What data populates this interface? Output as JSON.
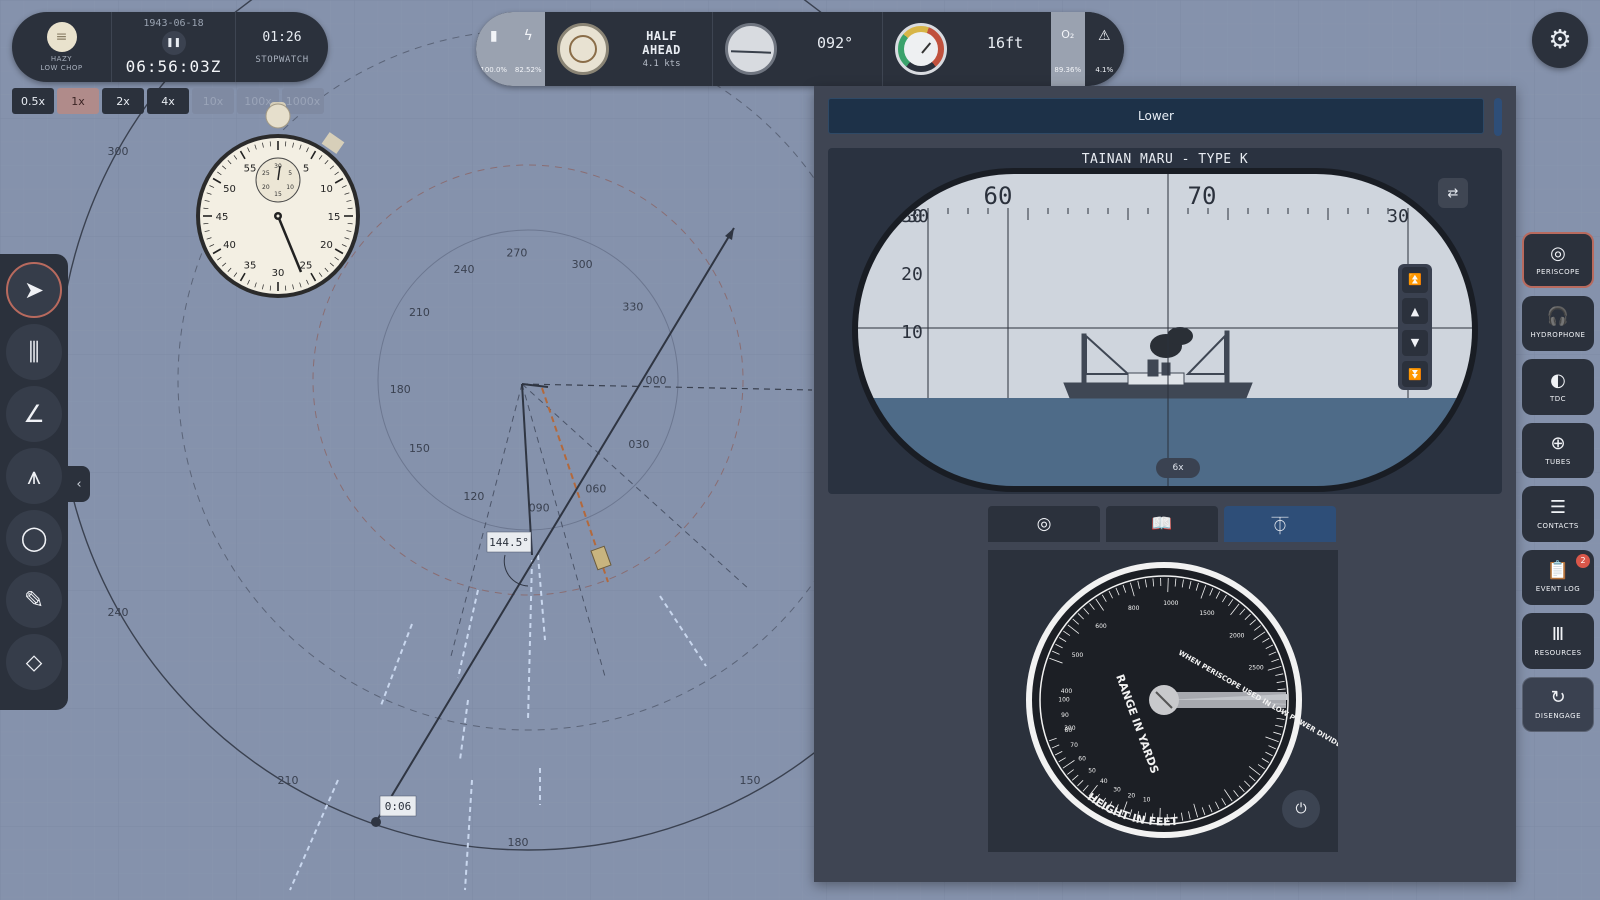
{
  "clock": {
    "weather_line1": "HAZY",
    "weather_line2": "LOW CHOP",
    "date": "1943-06-18",
    "pause_icon": "pause-icon",
    "time": "06:56:03Z",
    "stopwatch_time": "01:26",
    "stopwatch_label": "STOPWATCH"
  },
  "time_compression": [
    {
      "label": "0.5x",
      "state": "normal"
    },
    {
      "label": "1x",
      "state": "active"
    },
    {
      "label": "2x",
      "state": "normal"
    },
    {
      "label": "4x",
      "state": "normal"
    },
    {
      "label": "10x",
      "state": "disabled"
    },
    {
      "label": "100x",
      "state": "disabled"
    },
    {
      "label": "1000x",
      "state": "disabled"
    }
  ],
  "stopwatch_dial": {
    "outer_numbers": [
      "5",
      "10",
      "15",
      "20",
      "25",
      "30",
      "35",
      "40",
      "45",
      "50",
      "55"
    ],
    "inner_numbers": [
      "5",
      "10",
      "15",
      "20",
      "25",
      "30"
    ]
  },
  "status": {
    "battery_pct": "100.0%",
    "power_pct": "82.52%",
    "order": "HALF AHEAD",
    "speed": "4.1 kts",
    "heading": "092°",
    "depth": "16ft",
    "oxygen_symbol": "O₂",
    "oxygen_pct": "89.36%",
    "warning_pct": "4.1%"
  },
  "map": {
    "compass_labels": [
      "270",
      "300",
      "330",
      "000",
      "030",
      "060",
      "090",
      "120",
      "150",
      "180",
      "210",
      "240"
    ],
    "large_ring_labels": [
      "300",
      "240",
      "210",
      "180",
      "150"
    ],
    "bearing_label": "144.5°",
    "time_marker": "0:06"
  },
  "tools": [
    {
      "name": "select-tool",
      "icon": "➤",
      "active": true
    },
    {
      "name": "ruler-tool",
      "icon": "⫼",
      "active": false
    },
    {
      "name": "protractor-tool",
      "icon": "∠",
      "active": false
    },
    {
      "name": "compass-tool",
      "icon": "⩚",
      "active": false
    },
    {
      "name": "circle-tool",
      "icon": "◯",
      "active": false
    },
    {
      "name": "pencil-tool",
      "icon": "✎",
      "active": false
    },
    {
      "name": "eraser-tool",
      "icon": "⬦",
      "active": false
    }
  ],
  "collapse_icon": "‹",
  "periscope": {
    "header": "Lower",
    "target_title": "TAINAN MARU - TYPE K",
    "bearing_ticks": [
      "30",
      "60",
      "70",
      "30"
    ],
    "elevation_ticks": [
      "30",
      "20",
      "10"
    ],
    "zoom": "6x",
    "exit_icon": "⇄",
    "elev_buttons": [
      "⏫",
      "▲",
      "▼",
      "⏬"
    ]
  },
  "scope_tabs": [
    {
      "name": "target-tab",
      "icon": "◎",
      "active": false
    },
    {
      "name": "book-tab",
      "icon": "📖",
      "active": false
    },
    {
      "name": "rangefinder-tab",
      "icon": "⏁",
      "active": true
    }
  ],
  "rangefinder": {
    "text_range": "RANGE IN YARDS",
    "text_height": "HEIGHT IN FEET",
    "text_note": "WHEN PERISCOPE USED IN LOW POWER DIVIDE ALL RANGES BY 4",
    "range_numbers": [
      "2500",
      "2000",
      "1500",
      "1000",
      "800",
      "600",
      "500",
      "400",
      "300"
    ],
    "height_numbers": [
      "10",
      "20",
      "30",
      "40",
      "50",
      "60",
      "70",
      "80",
      "90",
      "100"
    ],
    "icon": "⏻"
  },
  "right_nav": [
    {
      "name": "periscope",
      "icon": "◎",
      "label": "PERISCOPE",
      "active": true
    },
    {
      "name": "hydrophone",
      "icon": "🎧",
      "label": "HYDROPHONE",
      "active": false
    },
    {
      "name": "tdc",
      "icon": "◐",
      "label": "TDC",
      "active": false
    },
    {
      "name": "tubes",
      "icon": "⊕",
      "label": "TUBES",
      "active": false
    },
    {
      "name": "contacts",
      "icon": "☰",
      "label": "CONTACTS",
      "active": false
    },
    {
      "name": "event-log",
      "icon": "📋",
      "label": "EVENT LOG",
      "active": false,
      "badge": "2"
    },
    {
      "name": "resources",
      "icon": "Ⅲ",
      "label": "RESOURCES",
      "active": false
    },
    {
      "name": "disengage",
      "icon": "↻",
      "label": "DISENGAGE",
      "active": false
    }
  ],
  "gear_icon": "⚙",
  "colors": {
    "map_bg": "#8592ac",
    "panel": "#2b313c",
    "accent_active": "#b86a5e",
    "scope_sky": "#cfd5dd",
    "scope_water": "#4e6b88"
  }
}
